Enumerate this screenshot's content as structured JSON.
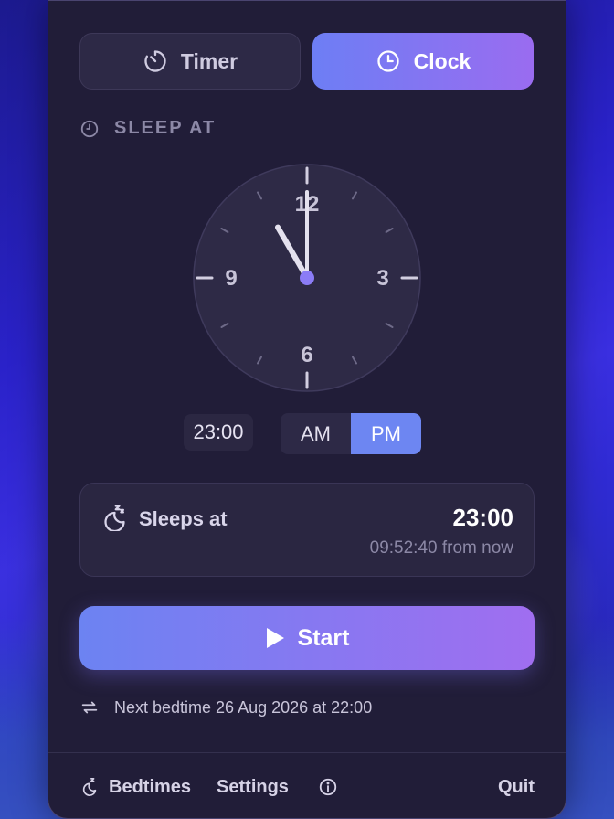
{
  "mode_tabs": [
    {
      "label": "Timer",
      "icon": "timer-icon",
      "active": false
    },
    {
      "label": "Clock",
      "icon": "clock-icon",
      "active": true
    }
  ],
  "section": {
    "label": "SLEEP AT",
    "icon": "clock-icon"
  },
  "clock_face": {
    "numerals": {
      "twelve": "12",
      "three": "3",
      "six": "6",
      "nine": "9"
    },
    "time": "23:00",
    "hour_hand_hour": 11,
    "minute": 0,
    "accent_color": "#8b7cf6"
  },
  "time_input": {
    "value": "23:00"
  },
  "period_toggle": {
    "am_label": "AM",
    "pm_label": "PM",
    "selected": "PM"
  },
  "sleep_card": {
    "label": "Sleeps at",
    "time": "23:00",
    "remaining": "09:52:40 from now",
    "icon": "moon-sleep-icon"
  },
  "start_button": {
    "label": "Start",
    "icon": "play-icon"
  },
  "next_bedtime": {
    "text": "Next bedtime 26 Aug 2026 at 22:00",
    "icon": "repeat-icon"
  },
  "footer": {
    "bedtimes_label": "Bedtimes",
    "settings_label": "Settings",
    "quit_label": "Quit",
    "bedtimes_icon": "moon-sleep-icon",
    "info_icon": "info-icon"
  },
  "colors": {
    "panel_bg": "#211d38",
    "gradient_start": "#6d7ef4",
    "gradient_end": "#9a6cf0",
    "pm_active": "#6d86f2"
  }
}
